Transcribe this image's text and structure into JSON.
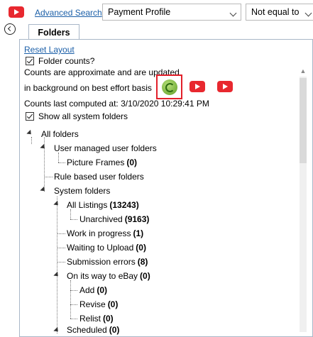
{
  "toolbar": {
    "advanced_search": "Advanced Search",
    "profile_select": "Payment Profile",
    "operator_select": "Not equal to"
  },
  "tab": {
    "label": "Folders"
  },
  "panel": {
    "reset_layout": "Reset Layout",
    "folder_counts_label": "Folder counts?",
    "note_line1": "Counts are approximate and are updated",
    "note_line2": "in background on best effort basis",
    "last_computed": "Counts last computed at: 3/10/2020 10:29:41 PM",
    "show_system_label": "Show all system folders"
  },
  "tree": {
    "all_folders": "All folders",
    "user_managed": "User managed user folders",
    "picture_frames": "Picture Frames",
    "picture_frames_count": "(0)",
    "rule_based": "Rule based user folders",
    "system_folders": "System folders",
    "all_listings": "All Listings",
    "all_listings_count": "(13243)",
    "unarchived": "Unarchived",
    "unarchived_count": "(9163)",
    "work_in_progress": "Work in progress",
    "work_in_progress_count": "(1)",
    "waiting_upload": "Waiting to Upload",
    "waiting_upload_count": "(0)",
    "submission_errors": "Submission errors",
    "submission_errors_count": "(8)",
    "on_way_ebay": "On its way to eBay",
    "on_way_ebay_count": "(0)",
    "add": "Add",
    "add_count": "(0)",
    "revise": "Revise",
    "revise_count": "(0)",
    "relist": "Relist",
    "relist_count": "(0)",
    "scheduled": "Scheduled",
    "scheduled_count": "(0)"
  },
  "colors": {
    "link": "#1b5fa8",
    "highlight": "#e2202a",
    "youtube": "#e8282f"
  }
}
